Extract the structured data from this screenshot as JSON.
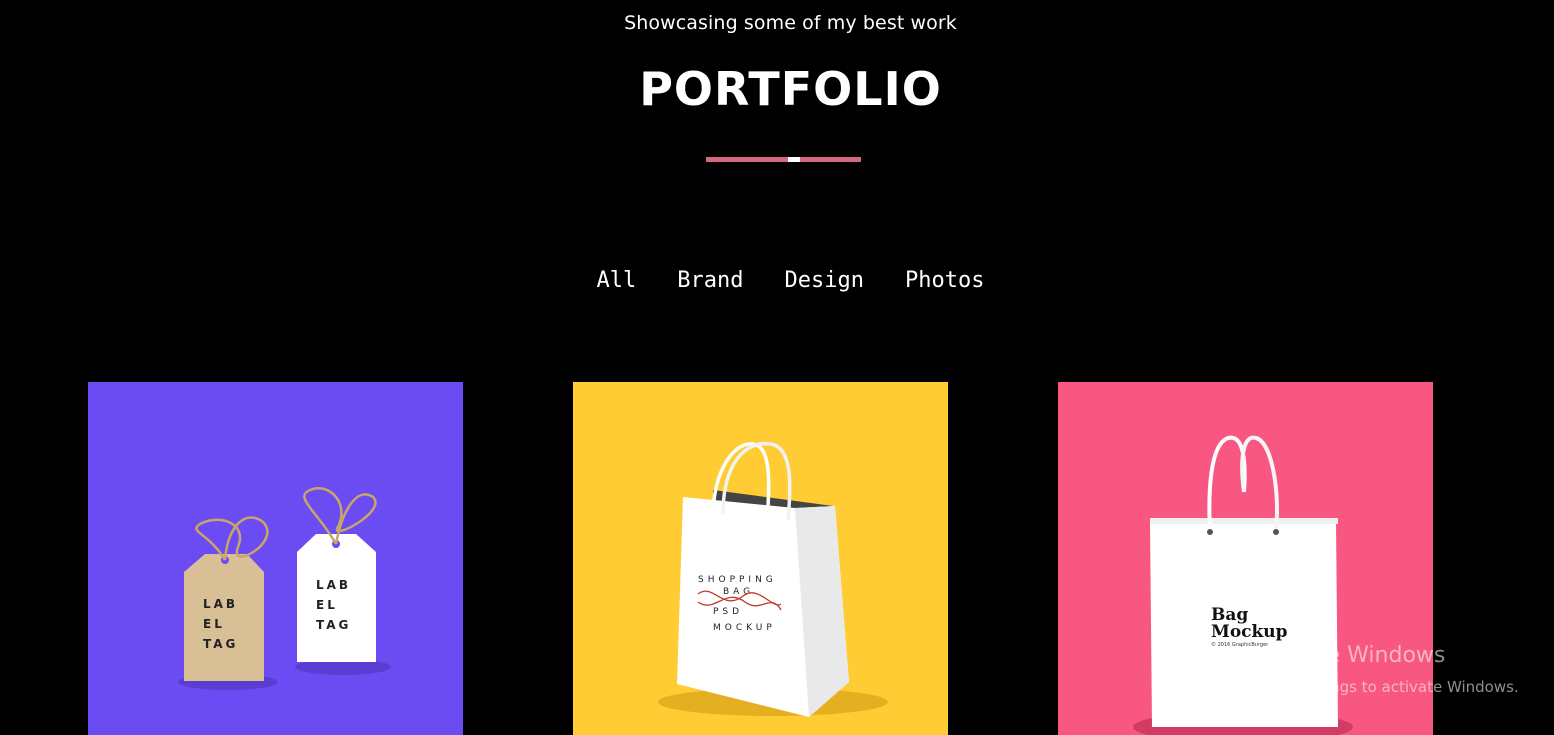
{
  "header": {
    "subtitle": "Showcasing some of my best work",
    "title": "PORTFOLIO"
  },
  "colors": {
    "background": "#000000",
    "divider": "#d4687f",
    "card_purple": "#6b4bf2",
    "card_yellow": "#ffcc33",
    "card_pink": "#f75781"
  },
  "filters": [
    "All",
    "Brand",
    "Design",
    "Photos"
  ],
  "cards": [
    {
      "tag_lines": [
        "LAB",
        "EL",
        "TAG"
      ],
      "tag2_lines": [
        "LAB",
        "EL",
        "TAG"
      ]
    },
    {
      "bag_lines": [
        "SHOPPING",
        "BAG",
        "PSD",
        "MOCKUP"
      ]
    },
    {
      "bag_title": [
        "Bag",
        "Mockup"
      ],
      "bag_caption": "© 2016 GraphicBurger"
    }
  ],
  "watermark": {
    "title": "Activate Windows",
    "subtitle": "Go to Settings to activate Windows."
  }
}
